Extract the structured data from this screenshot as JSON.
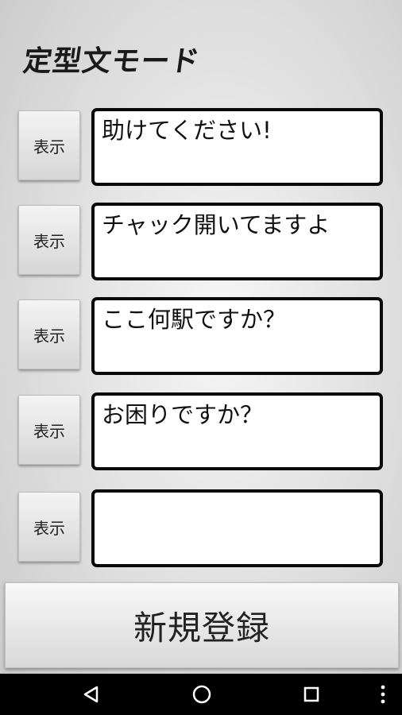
{
  "header": {
    "title": "定型文モード"
  },
  "rows": [
    {
      "show_label": "表示",
      "text": "助けてください!"
    },
    {
      "show_label": "表示",
      "text": "チャック開いてますよ"
    },
    {
      "show_label": "表示",
      "text": "ここ何駅ですか？"
    },
    {
      "show_label": "表示",
      "text": "お困りですか？"
    },
    {
      "show_label": "表示",
      "text": ""
    }
  ],
  "footer": {
    "register_label": "新規登録"
  },
  "navbar": {
    "icons": [
      "back-triangle-icon",
      "home-circle-icon",
      "recents-square-icon",
      "more-vertical-icon"
    ]
  },
  "colors": {
    "background": "#dcdcdc",
    "box_border": "#0a0a0a",
    "navbar": "#000000"
  }
}
